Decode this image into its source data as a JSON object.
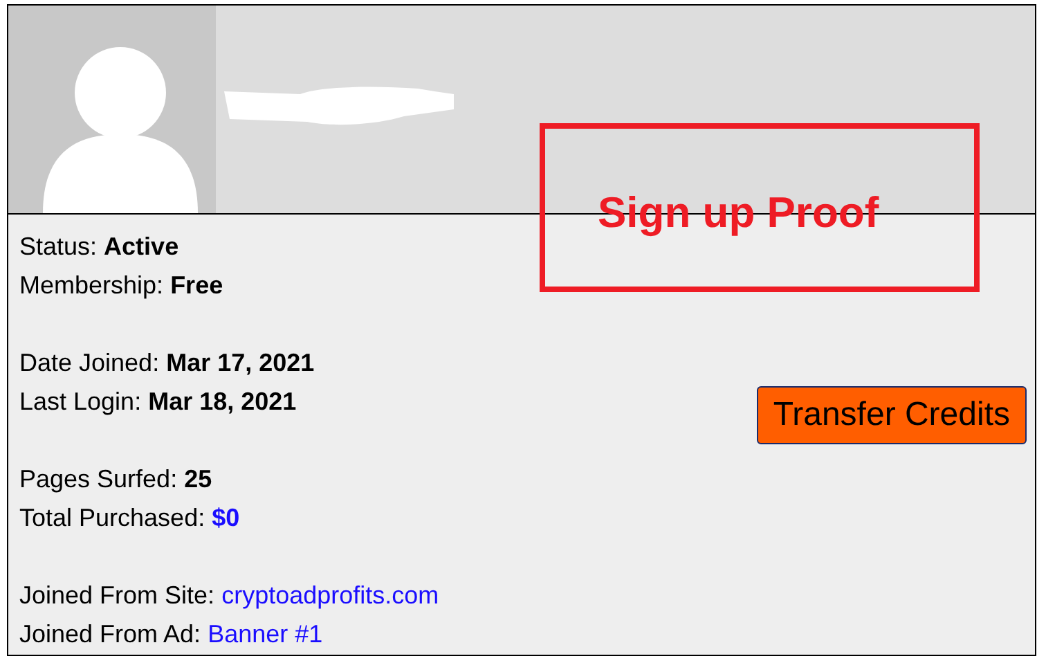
{
  "profile": {
    "avatar": {
      "kind": "silhouette"
    },
    "username": {
      "redacted": true
    }
  },
  "details": [
    [
      {
        "label": "Status:",
        "value": "Active",
        "kind": "bold"
      },
      {
        "label": "Membership:",
        "value": "Free",
        "kind": "bold"
      }
    ],
    [
      {
        "label": "Date Joined:",
        "value": "Mar 17, 2021",
        "kind": "bold"
      },
      {
        "label": "Last Login:",
        "value": "Mar 18, 2021",
        "kind": "bold"
      }
    ],
    [
      {
        "label": "Pages Surfed:",
        "value": "25",
        "kind": "bold"
      },
      {
        "label": "Total Purchased:",
        "value": "$0",
        "kind": "bold_link"
      }
    ],
    [
      {
        "label": "Joined From Site:",
        "value": "cryptoadprofits.com",
        "kind": "link"
      },
      {
        "label": "Joined From Ad:",
        "value": "Banner #1",
        "kind": "link"
      }
    ]
  ],
  "actions": [
    {
      "label": "Transfer Credits"
    }
  ],
  "annotation": {
    "text": "Sign up Proof"
  }
}
